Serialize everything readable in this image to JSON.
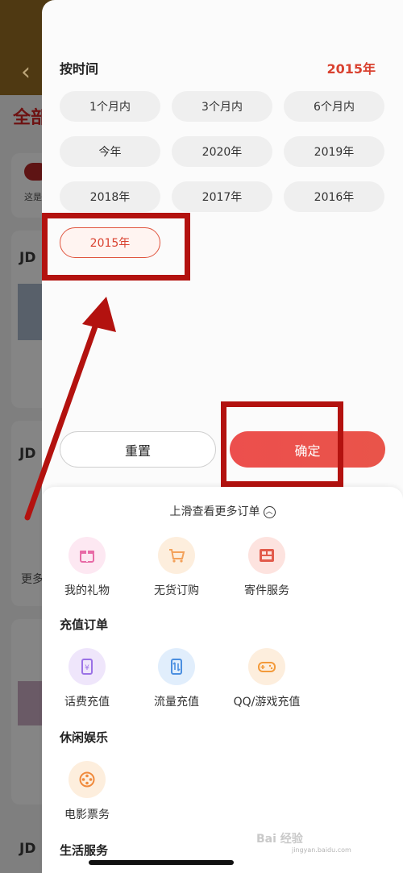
{
  "background": {
    "tab_label": "全部",
    "small_text": "这是",
    "more_text": "更多",
    "shop_mark": "JD"
  },
  "filter": {
    "title": "按时间",
    "selected_value": "2015年",
    "options": [
      "1个月内",
      "3个月内",
      "6个月内",
      "今年",
      "2020年",
      "2019年",
      "2018年",
      "2017年",
      "2016年",
      "2015年"
    ],
    "active_option": "2015年"
  },
  "buttons": {
    "reset_label": "重置",
    "confirm_label": "确定"
  },
  "sheet": {
    "slide_hint": "上滑查看更多订单",
    "top_items": [
      {
        "label": "我的礼物",
        "icon": "gift-icon",
        "color": "#e86aa6"
      },
      {
        "label": "无货订购",
        "icon": "cart-icon",
        "color": "#f3a15a"
      },
      {
        "label": "寄件服务",
        "icon": "parcel-icon",
        "color": "#e25a4b"
      }
    ],
    "recharge_title": "充值订单",
    "recharge_items": [
      {
        "label": "话费充值",
        "icon": "phone-bill-icon",
        "color": "#9b72e6"
      },
      {
        "label": "流量充值",
        "icon": "data-traffic-icon",
        "color": "#4b8fe0"
      },
      {
        "label": "QQ/游戏充值",
        "icon": "gamepad-icon",
        "color": "#f39a3a"
      }
    ],
    "leisure_title": "休闲娱乐",
    "leisure_items": [
      {
        "label": "电影票务",
        "icon": "film-reel-icon",
        "color": "#f08a3c"
      }
    ],
    "life_title": "生活服务"
  },
  "watermark": {
    "text": "Bai 经验",
    "sub": "jingyan.baidu.com"
  },
  "annotation_color": "#b3120f"
}
